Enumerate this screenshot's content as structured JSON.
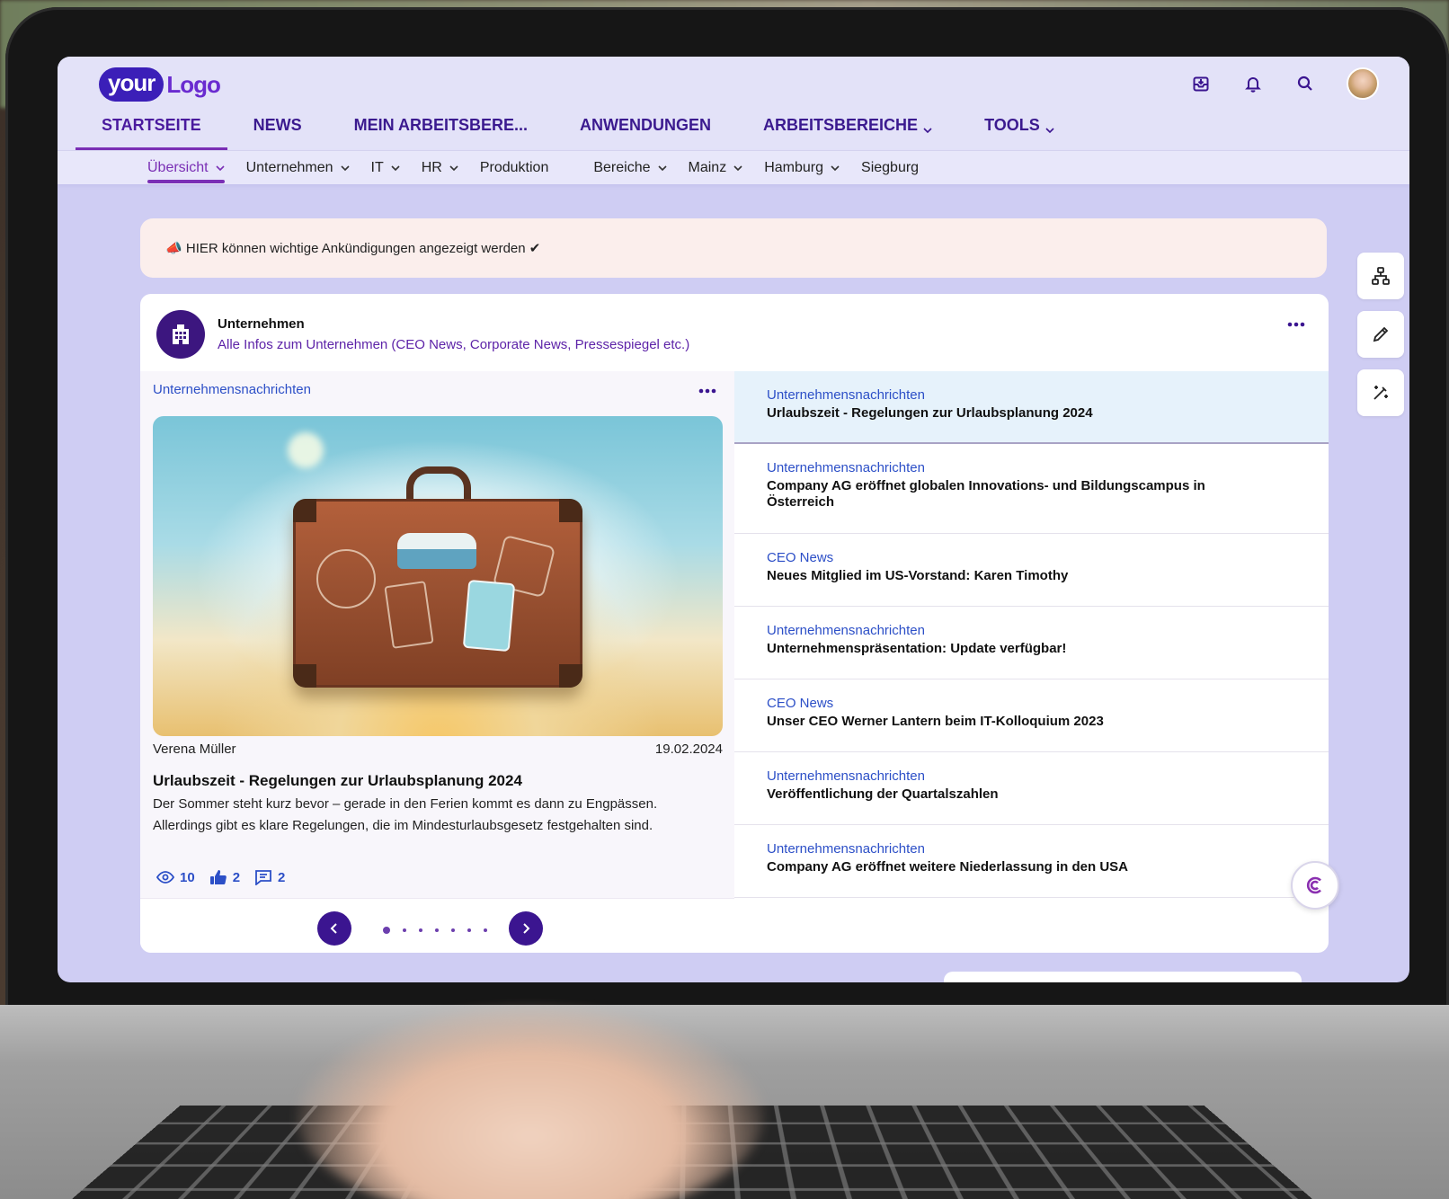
{
  "logo": {
    "part1": "your",
    "part2": "Logo"
  },
  "mainnav": [
    {
      "label": "STARTSEITE",
      "active": true,
      "has_dropdown": false
    },
    {
      "label": "NEWS",
      "active": false,
      "has_dropdown": false
    },
    {
      "label": "MEIN ARBEITSBERE...",
      "active": false,
      "has_dropdown": false
    },
    {
      "label": "ANWENDUNGEN",
      "active": false,
      "has_dropdown": false
    },
    {
      "label": "ARBEITSBEREICHE",
      "active": false,
      "has_dropdown": true
    },
    {
      "label": "TOOLS",
      "active": false,
      "has_dropdown": true
    }
  ],
  "subnav": [
    {
      "label": "Übersicht",
      "active": true,
      "has_dropdown": true
    },
    {
      "label": "Unternehmen",
      "active": false,
      "has_dropdown": true
    },
    {
      "label": "IT",
      "active": false,
      "has_dropdown": true
    },
    {
      "label": "HR",
      "active": false,
      "has_dropdown": true
    },
    {
      "label": "Produktion",
      "active": false,
      "has_dropdown": false
    },
    {
      "label": "Bereiche",
      "active": false,
      "has_dropdown": true
    },
    {
      "label": "Mainz",
      "active": false,
      "has_dropdown": true
    },
    {
      "label": "Hamburg",
      "active": false,
      "has_dropdown": true
    },
    {
      "label": "Siegburg",
      "active": false,
      "has_dropdown": false
    }
  ],
  "announcement": {
    "icon": "📣",
    "text": "HIER können wichtige Ankündigungen angezeigt werden ✔"
  },
  "card": {
    "title": "Unternehmen",
    "subtitle": "Alle Infos zum Unternehmen (CEO News, Corporate News, Pressespiegel etc.)"
  },
  "featured": {
    "category": "Unternehmensnachrichten",
    "author": "Verena Müller",
    "date": "19.02.2024",
    "title": "Urlaubszeit - Regelungen zur Urlaubsplanung 2024",
    "text": "Der Sommer steht kurz bevor – gerade in den Ferien kommt es dann zu Engpässen. Allerdings gibt es klare Regelungen, die im Mindesturlaubsgesetz festgehalten sind.",
    "views": "10",
    "likes": "2",
    "comments": "2",
    "slides_total": 7,
    "slide_active": 1
  },
  "news_list": [
    {
      "category": "Unternehmensnachrichten",
      "title": "Urlaubszeit - Regelungen zur Urlaubsplanung 2024",
      "active": true
    },
    {
      "category": "Unternehmensnachrichten",
      "title": "Company AG eröffnet globalen Innovations- und Bildungscampus in Österreich",
      "active": false
    },
    {
      "category": "CEO News",
      "title": "Neues Mitglied im US-Vorstand: Karen Timothy",
      "active": false
    },
    {
      "category": "Unternehmensnachrichten",
      "title": "Unternehmenspräsentation: Update verfügbar!",
      "active": false
    },
    {
      "category": "CEO News",
      "title": "Unser CEO Werner Lantern beim IT-Kolloquium 2023",
      "active": false
    },
    {
      "category": "Unternehmensnachrichten",
      "title": "Veröffentlichung der Quartalszahlen",
      "active": false
    },
    {
      "category": "Unternehmensnachrichten",
      "title": "Company AG eröffnet weitere Niederlassung in den USA",
      "active": false
    }
  ],
  "colors": {
    "primary": "#3b1590",
    "accent": "#7a2fb5",
    "link": "#2c4fc7",
    "page_bg": "#cfcdf3"
  },
  "icons": [
    "inbox-icon",
    "bell-icon",
    "search-icon",
    "sitemap-icon",
    "pencil-icon",
    "magic-wand-icon",
    "building-icon",
    "more-dots-icon",
    "eye-icon",
    "thumbs-up-icon",
    "comment-icon",
    "chevron-left-icon",
    "chevron-right-icon",
    "chatbot-icon"
  ]
}
